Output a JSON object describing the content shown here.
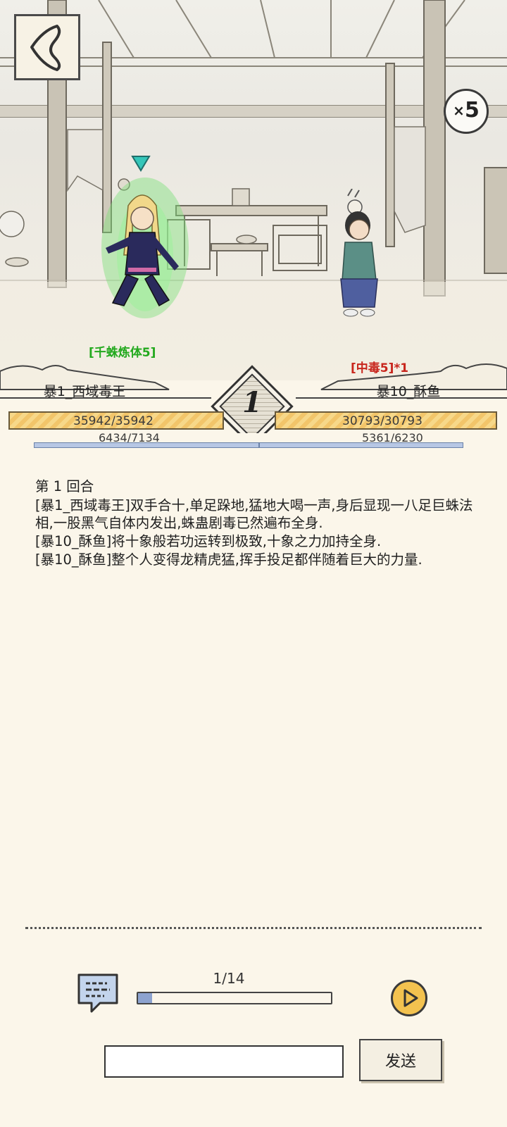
{
  "scene": {
    "speed": "5",
    "speed_prefix": "×",
    "left_status": "[千蛛炼体5]",
    "right_status": "[中毒5]*1"
  },
  "round_badge": "1",
  "left_fighter": {
    "name": "暴1_西域毒王",
    "hp": "35942/35942",
    "mp": "6434/7134",
    "hp_fraction": 1.0,
    "mp_fraction": 0.902
  },
  "right_fighter": {
    "name": "暴10_酥鱼",
    "hp": "30793/30793",
    "mp": "5361/6230",
    "hp_fraction": 1.0,
    "mp_fraction": 0.861
  },
  "log": {
    "round_title": "第 1 回合",
    "lines": [
      "[暴1_西域毒王]双手合十,单足跺地,猛地大喝一声,身后显现一八足巨蛛法相,一股黑气自体内发出,蛛蛊剧毒已然遍布全身.",
      "[暴10_酥鱼]将十象般若功运转到极致,十象之力加持全身.",
      "[暴10_酥鱼]整个人变得龙精虎猛,挥手投足都伴随着巨大的力量."
    ]
  },
  "controls": {
    "progress_text": "1/14",
    "progress_fraction": 0.0714,
    "input_value": "",
    "send_label": "发送"
  },
  "colors": {
    "background": "#fbf6ea",
    "hp_bar": "#f2c56a",
    "mp_bar": "#b7c7e4",
    "buff_green": "#23a91e",
    "debuff_red": "#c8251c",
    "play_button": "#f3c24f"
  }
}
